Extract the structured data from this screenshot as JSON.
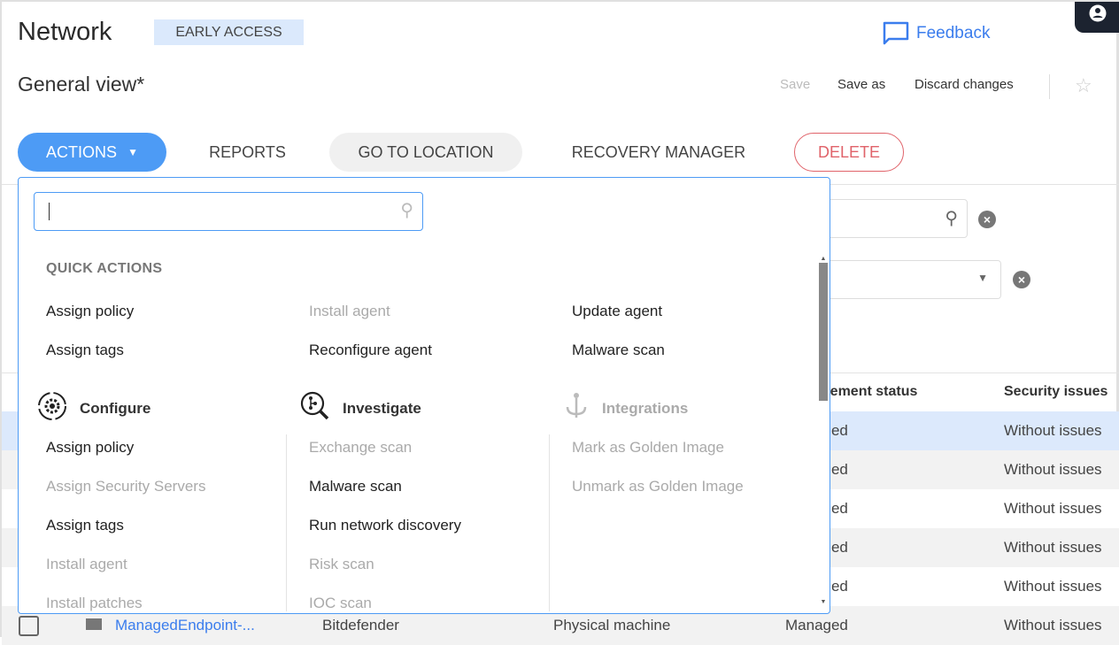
{
  "header": {
    "title": "Network",
    "badge": "EARLY ACCESS",
    "feedback": "Feedback",
    "view_name": "General view*",
    "save": "Save",
    "save_as": "Save as",
    "discard": "Discard changes"
  },
  "toolbar": {
    "actions": "ACTIONS",
    "reports": "REPORTS",
    "go_to_location": "GO TO LOCATION",
    "recovery_manager": "RECOVERY MANAGER",
    "delete": "DELETE"
  },
  "colors": {
    "accent": "#4d9bf5",
    "delete": "#e0636a",
    "selected_row": "#dce9fc"
  },
  "table": {
    "headers": [
      "Management status",
      "Security issues"
    ],
    "rows": [
      {
        "status": "Managed",
        "issues": "Without issues",
        "selected": true
      },
      {
        "status": "Managed",
        "issues": "Without issues"
      },
      {
        "status": "Managed",
        "issues": "Without issues"
      },
      {
        "status": "Managed",
        "issues": "Without issues"
      },
      {
        "status": "Managed",
        "issues": "Without issues"
      },
      {
        "name": "ManagedEndpoint-...",
        "vendor": "Bitdefender",
        "type": "Physical machine",
        "status": "Managed",
        "issues": "Without issues"
      }
    ]
  },
  "dropdown": {
    "search_value": "",
    "quick_actions_label": "QUICK ACTIONS",
    "quick_actions": [
      {
        "label": "Assign policy",
        "enabled": true
      },
      {
        "label": "Install agent",
        "enabled": false
      },
      {
        "label": "Update agent",
        "enabled": true
      },
      {
        "label": "Assign tags",
        "enabled": true
      },
      {
        "label": "Reconfigure agent",
        "enabled": true
      },
      {
        "label": "Malware scan",
        "enabled": true
      }
    ],
    "sections": [
      {
        "title": "Configure",
        "icon": "gear-icon",
        "items": [
          {
            "label": "Assign policy",
            "enabled": true
          },
          {
            "label": "Assign Security Servers",
            "enabled": false
          },
          {
            "label": "Assign tags",
            "enabled": true
          },
          {
            "label": "Install agent",
            "enabled": false
          },
          {
            "label": "Install patches",
            "enabled": false
          }
        ]
      },
      {
        "title": "Investigate",
        "icon": "investigate-icon",
        "items": [
          {
            "label": "Exchange scan",
            "enabled": false
          },
          {
            "label": "Malware scan",
            "enabled": true
          },
          {
            "label": "Run network discovery",
            "enabled": true
          },
          {
            "label": "Risk scan",
            "enabled": false
          },
          {
            "label": "IOC scan",
            "enabled": false
          }
        ]
      },
      {
        "title": "Integrations",
        "icon": "integrations-icon",
        "enabled": false,
        "items": [
          {
            "label": "Mark as Golden Image",
            "enabled": false
          },
          {
            "label": "Unmark as Golden Image",
            "enabled": false
          }
        ]
      }
    ]
  }
}
